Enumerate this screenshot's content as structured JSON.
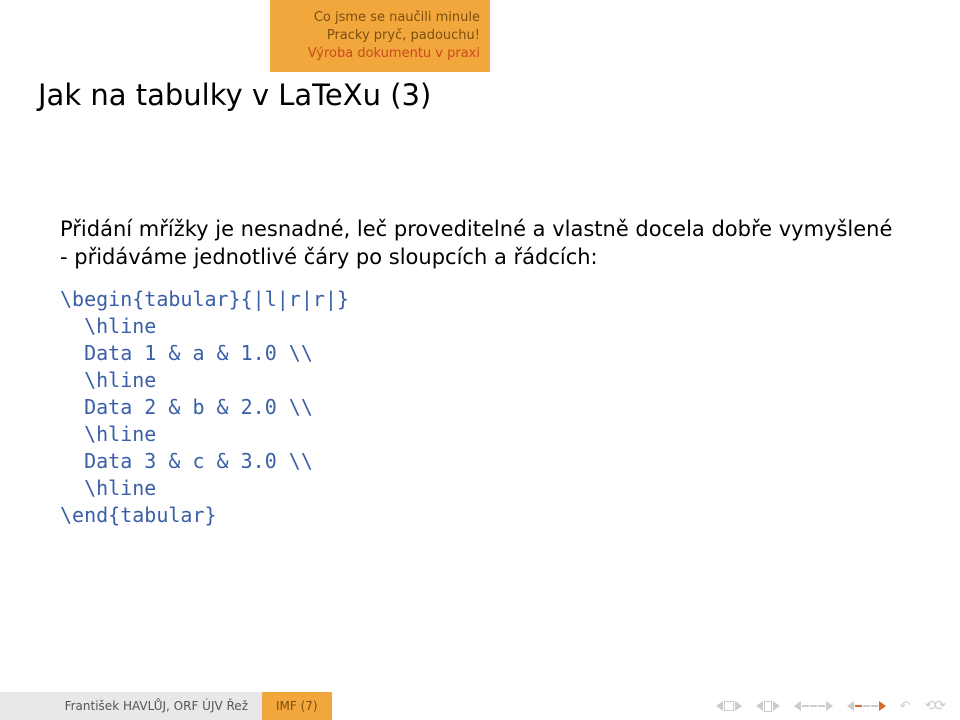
{
  "header": {
    "items": [
      {
        "label": "Co jsme se naučili minule",
        "active": false
      },
      {
        "label": "Pracky pryč, padouchu!",
        "active": false
      },
      {
        "label": "Výroba dokumentu v praxi",
        "active": true
      }
    ]
  },
  "title": "Jak na tabulky v LaTeXu (3)",
  "body": {
    "paragraph": "Přidání mřížky je nesnadné, leč proveditelné a vlastně docela dobře vymyšlené - přidáváme jednotlivé čáry po sloupcích a řádcích:",
    "code": "\\begin{tabular}{|l|r|r|}\n  \\hline\n  Data 1 & a & 1.0 \\\\\n  \\hline\n  Data 2 & b & 2.0 \\\\\n  \\hline\n  Data 3 & c & 3.0 \\\\\n  \\hline\n\\end{tabular}"
  },
  "footer": {
    "author": "František HAVLŮJ, ORF ÚJV Řež",
    "short_title": "IMF (7)"
  }
}
